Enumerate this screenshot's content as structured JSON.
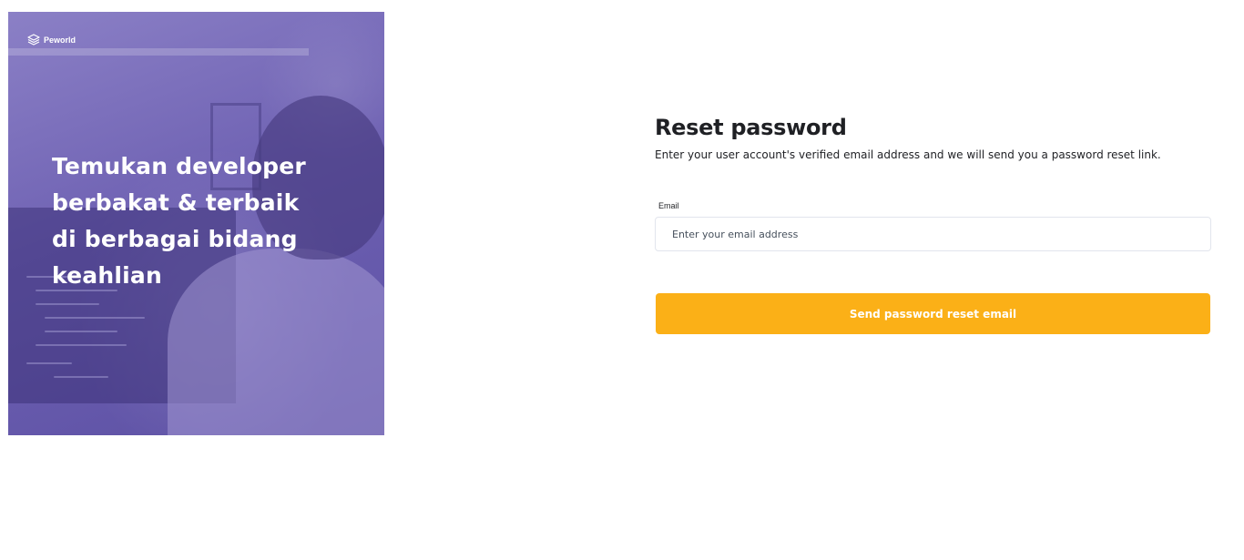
{
  "brand": {
    "name": "Peworld",
    "icon": "layers-icon"
  },
  "hero": {
    "headline_lines": [
      "Temukan developer",
      "berbakat & terbaik",
      "di berbagai bidang",
      "keahlian"
    ],
    "overlay_color": "#5e50a1"
  },
  "form": {
    "title": "Reset password",
    "subtitle": "Enter your user account's verified email address and we will send you a password reset link.",
    "email": {
      "label": "Email",
      "placeholder": "Enter your email address",
      "value": ""
    },
    "submit_label": "Send password reset email",
    "accent_color": "#fbb017"
  }
}
